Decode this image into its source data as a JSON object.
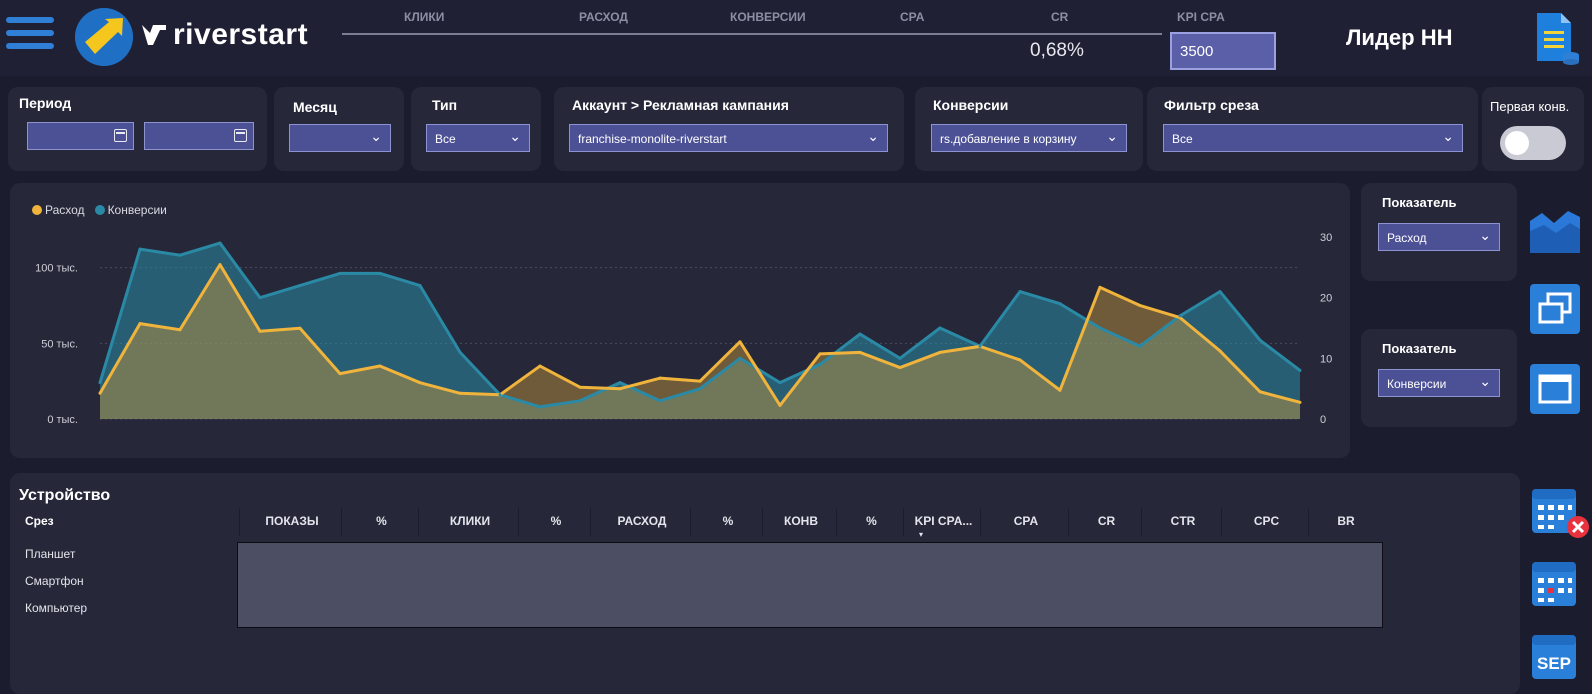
{
  "header": {
    "brand": "riverstart",
    "kpi_labels": [
      "КЛИКИ",
      "РАСХОД",
      "КОНВЕРСИИ",
      "CPA",
      "CR",
      "KPI CPA"
    ],
    "cr_value": "0,68%",
    "kpi_cpa_value": "3500",
    "title": "Лидер НН",
    "icons": [
      "menu-icon",
      "logo-arrow-icon",
      "document-icon"
    ]
  },
  "filters": {
    "period": {
      "label": "Период"
    },
    "month": {
      "label": "Месяц"
    },
    "type": {
      "label": "Тип",
      "value": "Все"
    },
    "account": {
      "label": "Аккаунт > Рекламная кампания",
      "value": "franchise-monolite-riverstart"
    },
    "conversions": {
      "label": "Конверсии",
      "value": "rs.добавление в корзину"
    },
    "slice_filter": {
      "label": "Фильтр среза",
      "value": "Все"
    },
    "first_conv": {
      "label": "Первая конв.",
      "toggle": false
    }
  },
  "chart_data": {
    "type": "area",
    "legend": [
      "Расход",
      "Конверсии"
    ],
    "legend_colors": [
      "#f0b43c",
      "#2a8aa5"
    ],
    "y_left_ticks": [
      "0 тыс.",
      "50 тыс.",
      "100 тыс."
    ],
    "y_left_lim": [
      0,
      150000
    ],
    "y_right_ticks": [
      "0",
      "10",
      "20",
      "30"
    ],
    "y_right_lim": [
      0,
      30
    ],
    "series": [
      {
        "name": "Расход",
        "axis": "left",
        "values": [
          17000,
          63000,
          59000,
          102000,
          58000,
          60000,
          30000,
          35000,
          24000,
          17000,
          16000,
          35000,
          21000,
          20000,
          27000,
          25000,
          51000,
          9000,
          43000,
          44000,
          34000,
          44000,
          48000,
          39000,
          19000,
          87000,
          75000,
          67000,
          45000,
          18000,
          11000
        ]
      },
      {
        "name": "Конверсии",
        "axis": "right",
        "values": [
          6,
          28,
          27,
          29,
          20,
          22,
          24,
          24,
          22,
          11,
          4,
          2,
          3,
          6,
          3,
          5,
          10,
          6,
          9,
          14,
          10,
          15,
          12,
          21,
          19,
          15,
          12,
          17,
          21,
          13,
          8
        ]
      }
    ]
  },
  "indicators": [
    {
      "label": "Показатель",
      "value": "Расход"
    },
    {
      "label": "Показатель",
      "value": "Конверсии"
    }
  ],
  "side_icons": [
    "area-chart-icon",
    "copy-windows-icon",
    "window-icon",
    "calendar-remove-icon",
    "calendar-icon",
    "sep-calendar-icon"
  ],
  "side_labels": {
    "sep": "SEP"
  },
  "device_table": {
    "title": "Устройство",
    "slice_header": "Срез",
    "columns": [
      "ПОКАЗЫ",
      "%",
      "КЛИКИ",
      "%",
      "РАСХОД",
      "%",
      "КОНВ",
      "%",
      "KPI CPA...",
      "CPA",
      "CR",
      "CTR",
      "CPC",
      "BR"
    ],
    "rows": [
      "Планшет",
      "Смартфон",
      "Компьютер"
    ]
  },
  "colors": {
    "accent": "#4c5196",
    "background": "#1b1c2e",
    "card": "#262839"
  }
}
